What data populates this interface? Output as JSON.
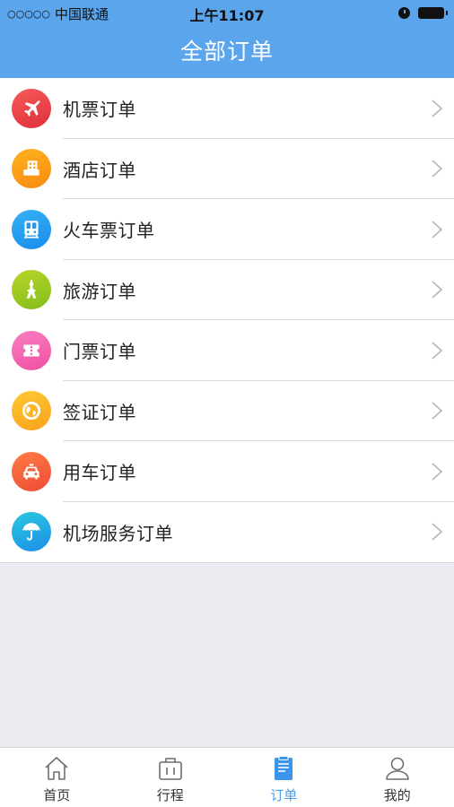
{
  "status_bar": {
    "signal": "○○○○○",
    "carrier": "中国联通",
    "time": "上午11:07",
    "icons": [
      "alarm-icon",
      "battery-icon"
    ]
  },
  "header": {
    "title": "全部订单"
  },
  "colors": {
    "header_bg": "#5aa5ec",
    "active_tab": "#4a9eea",
    "page_bg": "#ebebf1"
  },
  "orders": [
    {
      "label": "机票订单",
      "icon": "airplane-icon",
      "color_from": "#f55a5a",
      "color_to": "#e0303a"
    },
    {
      "label": "酒店订单",
      "icon": "hotel-icon",
      "color_from": "#ffb21e",
      "color_to": "#f78a10"
    },
    {
      "label": "火车票订单",
      "icon": "train-icon",
      "color_from": "#35b2f6",
      "color_to": "#1b8be8"
    },
    {
      "label": "旅游订单",
      "icon": "tower-icon",
      "color_from": "#b8d628",
      "color_to": "#82bd1c"
    },
    {
      "label": "门票订单",
      "icon": "ticket-icon",
      "color_from": "#fa7fc2",
      "color_to": "#ef4fa1"
    },
    {
      "label": "签证订单",
      "icon": "globe-icon",
      "color_from": "#ffc934",
      "color_to": "#f9a11c"
    },
    {
      "label": "用车订单",
      "icon": "car-icon",
      "color_from": "#ff7c44",
      "color_to": "#ee4a35"
    },
    {
      "label": "机场服务订单",
      "icon": "umbrella-icon",
      "color_from": "#2cc7df",
      "color_to": "#1a8fe8"
    }
  ],
  "tabbar": [
    {
      "label": "首页",
      "icon": "home-icon",
      "active": false
    },
    {
      "label": "行程",
      "icon": "suitcase-icon",
      "active": false
    },
    {
      "label": "订单",
      "icon": "clipboard-icon",
      "active": true
    },
    {
      "label": "我的",
      "icon": "user-icon",
      "active": false
    }
  ]
}
